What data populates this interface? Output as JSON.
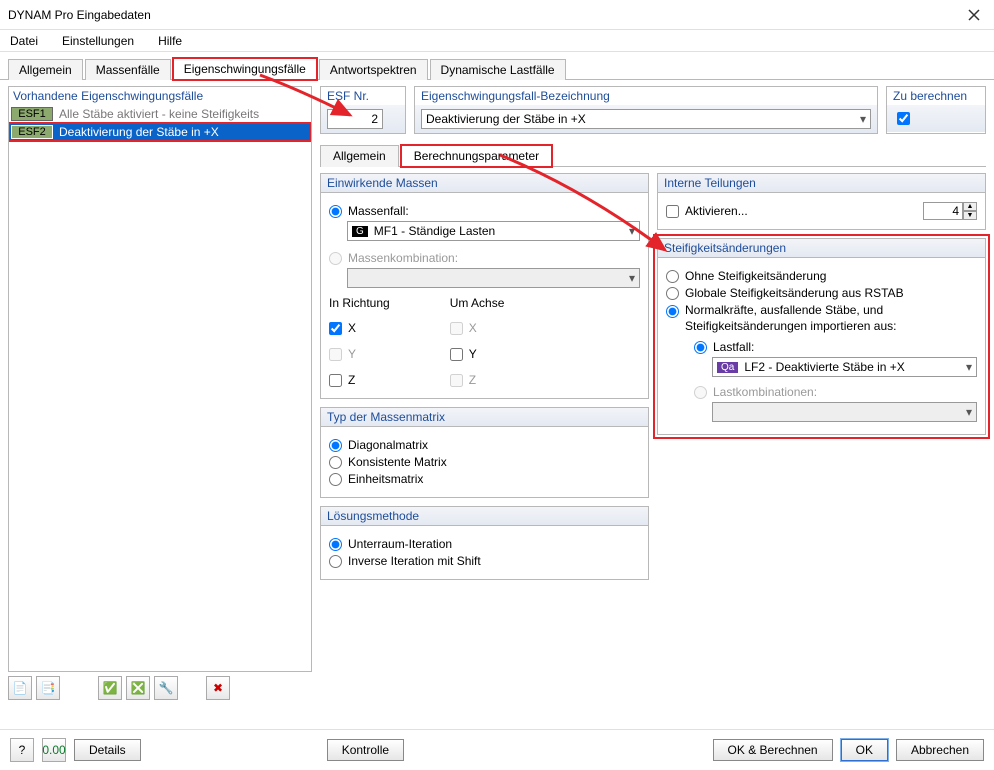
{
  "window": {
    "title": "DYNAM Pro Eingabedaten"
  },
  "menubar": {
    "file": "Datei",
    "settings": "Einstellungen",
    "help": "Hilfe"
  },
  "main_tabs": {
    "items": [
      "Allgemein",
      "Massenfälle",
      "Eigenschwingungsfälle",
      "Antwortspektren",
      "Dynamische Lastfälle"
    ],
    "active_index": 2,
    "highlighted_index": 2
  },
  "left_panel": {
    "title": "Vorhandene Eigenschwingungsfälle",
    "cases": [
      {
        "badge": "ESF1",
        "desc": "Alle Stäbe aktiviert - keine Steifigkeits",
        "selected": false,
        "dim": true
      },
      {
        "badge": "ESF2",
        "desc": "Deaktivierung der Stäbe in +X",
        "selected": true,
        "highlighted": true
      }
    ]
  },
  "top": {
    "nr": {
      "label": "ESF Nr.",
      "value": "2"
    },
    "desc": {
      "label": "Eigenschwingungsfall-Bezeichnung",
      "value": "Deaktivierung der Stäbe in +X"
    },
    "calc": {
      "label": "Zu berechnen",
      "checked": true
    }
  },
  "sub_tabs": {
    "items": [
      "Allgemein",
      "Berechnungsparameter"
    ],
    "active_index": 1,
    "highlighted_index": 1
  },
  "masses": {
    "legend": "Einwirkende Massen",
    "massfall_label": "Massenfall:",
    "massfall_value": "MF1 - Ständige Lasten",
    "masscomb_label": "Massenkombination:",
    "dir_head": "In Richtung",
    "axis_head": "Um Achse",
    "X": "X",
    "Y": "Y",
    "Z": "Z"
  },
  "matrix": {
    "legend": "Typ der Massenmatrix",
    "opt1": "Diagonalmatrix",
    "opt2": "Konsistente Matrix",
    "opt3": "Einheitsmatrix"
  },
  "solver": {
    "legend": "Lösungsmethode",
    "opt1": "Unterraum-Iteration",
    "opt2": "Inverse Iteration mit Shift"
  },
  "divisions": {
    "legend": "Interne Teilungen",
    "activate": "Aktivieren...",
    "value": "4"
  },
  "stiffness": {
    "legend": "Steifigkeitsänderungen",
    "opt1": "Ohne Steifigkeitsänderung",
    "opt2": "Globale Steifigkeitsänderung aus RSTAB",
    "opt3": "Normalkräfte, ausfallende Stäbe, und Steifigkeitsänderungen importieren aus:",
    "lastfall_label": "Lastfall:",
    "lastfall_value": "LF2 - Deaktivierte Stäbe in +X",
    "lastkomb_label": "Lastkombinationen:"
  },
  "footer": {
    "details": "Details",
    "kontrolle": "Kontrolle",
    "ok_calc": "OK & Berechnen",
    "ok": "OK",
    "cancel": "Abbrechen"
  }
}
